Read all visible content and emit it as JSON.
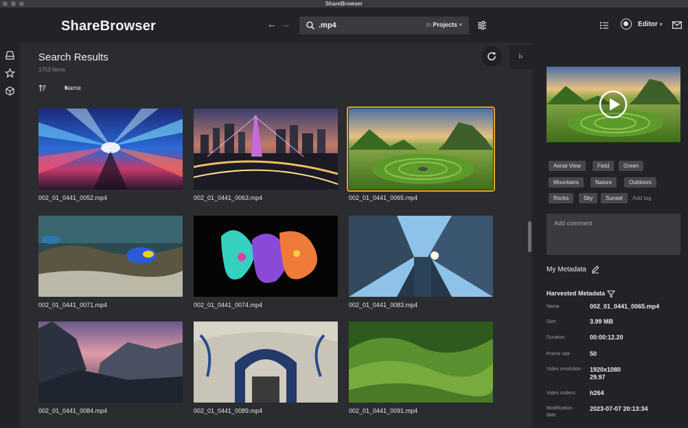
{
  "window": {
    "title": "ShareBrowser"
  },
  "header": {
    "logo": "ShareBrowser",
    "search": {
      "value": ".mp4",
      "scope_prefix": "in",
      "scope": "Projects"
    },
    "user": "Editor"
  },
  "main": {
    "title": "Search Results",
    "count": "1753 items",
    "sort_label": "Name",
    "info_tab_label": "i",
    "tiles": [
      {
        "filename": "002_01_0441_0052.mp4",
        "scene": "light-speed"
      },
      {
        "filename": "002_01_0441_0063.mp4",
        "scene": "city-bridge-night"
      },
      {
        "filename": "002_01_0441_0065.mp4",
        "scene": "green-fairy-glen",
        "selected": true
      },
      {
        "filename": "002_01_0441_0071.mp4",
        "scene": "aquarium-fish"
      },
      {
        "filename": "002_01_0441_0074.mp4",
        "scene": "paint-splash"
      },
      {
        "filename": "002_01_0441_0083.mp4",
        "scene": "skyscrapers-up"
      },
      {
        "filename": "002_01_0441_0084.mp4",
        "scene": "mountain-valley-dusk"
      },
      {
        "filename": "002_01_0441_0089.mp4",
        "scene": "subway-station-art"
      },
      {
        "filename": "002_01_0441_0091.mp4",
        "scene": "green-hills"
      }
    ]
  },
  "panel": {
    "tags": [
      "Aerial View",
      "Field",
      "Green",
      "Mountains",
      "Nature",
      "Outdoors",
      "Rocks",
      "Sky",
      "Sunset"
    ],
    "add_tag": "Add tag",
    "comment_placeholder": "Add comment",
    "my_metadata_title": "My Metadata",
    "harvested_title": "Harvested Metadata",
    "metadata": [
      {
        "label": "Name",
        "value": "002_01_0441_0065.mp4"
      },
      {
        "label": "Size",
        "value": "3.99 MB"
      },
      {
        "label": "Duration",
        "value": "00:00:12.20"
      },
      {
        "label": "Frame rate",
        "value": "50"
      },
      {
        "label": "Video resolution",
        "value": "1920x1080 29.97"
      },
      {
        "label": "Video codecs",
        "value": "h264"
      },
      {
        "label": "Modification date",
        "value": "2023-07-07 20:13:34"
      }
    ]
  },
  "colors": {
    "accent_selected": "#e6a821",
    "background": "#2b2c30",
    "panel": "#222326"
  }
}
